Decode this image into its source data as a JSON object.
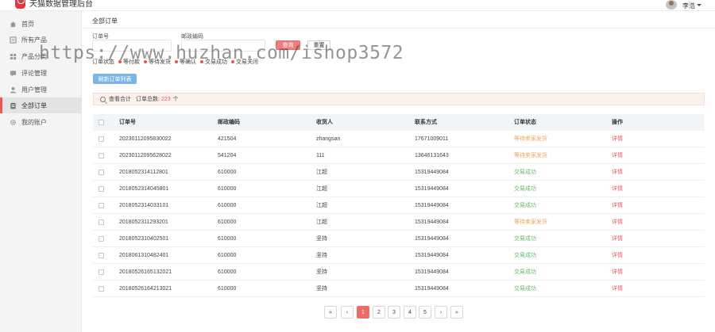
{
  "header": {
    "app_title": "天猫数据管理后台",
    "user_name": "李浩"
  },
  "sidebar": {
    "items": [
      {
        "label": "首页",
        "icon": "home-icon"
      },
      {
        "label": "所有产品",
        "icon": "product-icon"
      },
      {
        "label": "产品分类",
        "icon": "category-icon"
      },
      {
        "label": "评论管理",
        "icon": "comment-icon"
      },
      {
        "label": "用户管理",
        "icon": "user-icon"
      },
      {
        "label": "全部订单",
        "icon": "order-icon",
        "active": true
      },
      {
        "label": "我的账户",
        "icon": "gear-icon"
      }
    ]
  },
  "page": {
    "breadcrumb": "全部订单"
  },
  "filters": {
    "order_no_label": "订单号",
    "order_no_value": "",
    "zip_label": "邮政编码",
    "zip_value": "",
    "query_label": "查询",
    "reset_label": "重置",
    "status_label": "订单状态",
    "status_options": [
      "等付款",
      "等待发货",
      "等确认",
      "交易成功",
      "交易关闭"
    ]
  },
  "refresh_label": "刷新订单列表",
  "summary": {
    "text": "查看合计",
    "total_label": "订单总数:",
    "total_value": "223",
    "unit": "个"
  },
  "table": {
    "headers": [
      "订单号",
      "邮政编码",
      "收货人",
      "联系方式",
      "订单状态",
      "操作"
    ],
    "rows": [
      {
        "order_no": "20230112095830022",
        "zip": "421504",
        "receiver": "zhangsan",
        "phone": "17671009011",
        "status": "等待卖家发货",
        "status_type": "wait",
        "op": "详情"
      },
      {
        "order_no": "20230112095628022",
        "zip": "541204",
        "receiver": "111",
        "phone": "13646131643",
        "status": "等待卖家发货",
        "status_type": "wait",
        "op": "详情"
      },
      {
        "order_no": "2018052314112801",
        "zip": "610000",
        "receiver": "江超",
        "phone": "15319449084",
        "status": "交易成功",
        "status_type": "ok",
        "op": "详情"
      },
      {
        "order_no": "2018052314045801",
        "zip": "610000",
        "receiver": "江超",
        "phone": "15319449084",
        "status": "交易成功",
        "status_type": "ok",
        "op": "详情"
      },
      {
        "order_no": "2018052314033101",
        "zip": "610000",
        "receiver": "江超",
        "phone": "15319449084",
        "status": "交易成功",
        "status_type": "ok",
        "op": "详情"
      },
      {
        "order_no": "2018052311293201",
        "zip": "610000",
        "receiver": "江超",
        "phone": "15319449084",
        "status": "等待卖家发货",
        "status_type": "wait",
        "op": "详情"
      },
      {
        "order_no": "2018052310402501",
        "zip": "610000",
        "receiver": "坚持",
        "phone": "15319449084",
        "status": "交易成功",
        "status_type": "ok",
        "op": "详情"
      },
      {
        "order_no": "2018061310482401",
        "zip": "610000",
        "receiver": "坚持",
        "phone": "15319449084",
        "status": "交易成功",
        "status_type": "ok",
        "op": "详情"
      },
      {
        "order_no": "20180526165132021",
        "zip": "610000",
        "receiver": "坚持",
        "phone": "15319449084",
        "status": "交易成功",
        "status_type": "ok",
        "op": "详情"
      },
      {
        "order_no": "20180526164213021",
        "zip": "610000",
        "receiver": "坚持",
        "phone": "15319449084",
        "status": "交易成功",
        "status_type": "ok",
        "op": "详情"
      }
    ]
  },
  "pagination": {
    "first": "«",
    "prev": "‹",
    "pages": [
      "1",
      "2",
      "3",
      "4",
      "5"
    ],
    "current": "1",
    "next": "›",
    "last": "»"
  },
  "watermark": "https://www.huzhan.com/ishop3572",
  "colors": {
    "accent": "#e9565a",
    "status_wait": "#f0a55a",
    "status_ok": "#68b86a",
    "refresh_button": "#7ab6e8"
  }
}
